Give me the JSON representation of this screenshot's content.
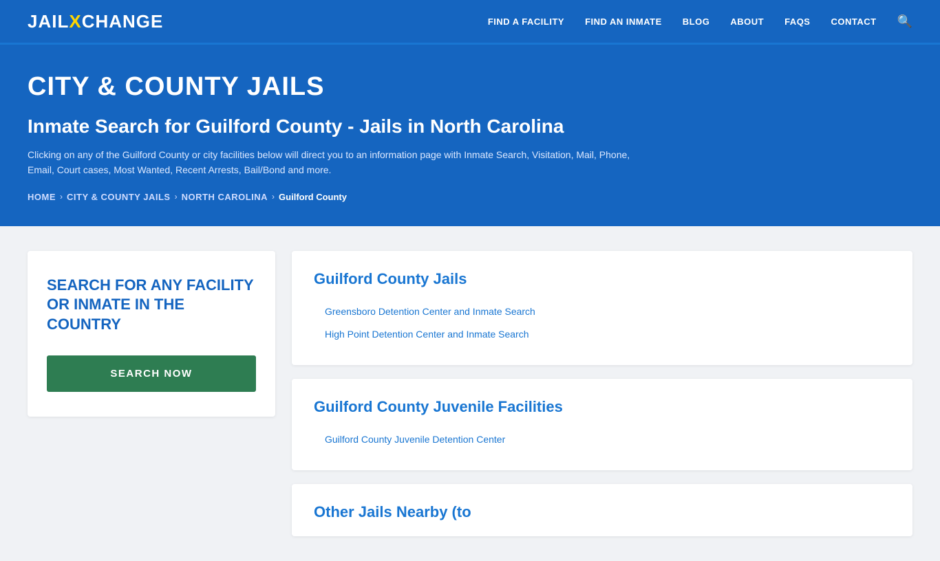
{
  "header": {
    "logo": {
      "part1": "JAIL",
      "x_letter": "X",
      "part2": "CHANGE"
    },
    "nav": [
      {
        "label": "FIND A FACILITY",
        "id": "find-facility"
      },
      {
        "label": "FIND AN INMATE",
        "id": "find-inmate"
      },
      {
        "label": "BLOG",
        "id": "blog"
      },
      {
        "label": "ABOUT",
        "id": "about"
      },
      {
        "label": "FAQs",
        "id": "faqs"
      },
      {
        "label": "CONTACT",
        "id": "contact"
      }
    ],
    "search_icon": "🔍"
  },
  "hero": {
    "title": "CITY & COUNTY JAILS",
    "subtitle": "Inmate Search for Guilford County - Jails in North Carolina",
    "description": "Clicking on any of the Guilford County or city facilities below will direct you to an information page with Inmate Search, Visitation, Mail, Phone, Email, Court cases, Most Wanted, Recent Arrests, Bail/Bond and more.",
    "breadcrumb": [
      {
        "label": "Home",
        "link": true
      },
      {
        "label": "City & County Jails",
        "link": true
      },
      {
        "label": "North Carolina",
        "link": true
      },
      {
        "label": "Guilford County",
        "link": false
      }
    ]
  },
  "left_panel": {
    "search_box": {
      "title": "SEARCH FOR ANY FACILITY OR INMATE IN THE COUNTRY",
      "button_label": "SEARCH NOW"
    }
  },
  "right_panel": {
    "cards": [
      {
        "id": "guilford-county-jails",
        "title": "Guilford County Jails",
        "facilities": [
          "Greensboro Detention Center and Inmate Search",
          "High Point Detention Center and Inmate Search"
        ]
      },
      {
        "id": "guilford-county-juvenile",
        "title": "Guilford County Juvenile Facilities",
        "facilities": [
          "Guilford County Juvenile Detention Center"
        ]
      },
      {
        "id": "other-jails-nearby",
        "title": "Other Jails Nearby (to",
        "partial": true,
        "facilities": []
      }
    ]
  }
}
